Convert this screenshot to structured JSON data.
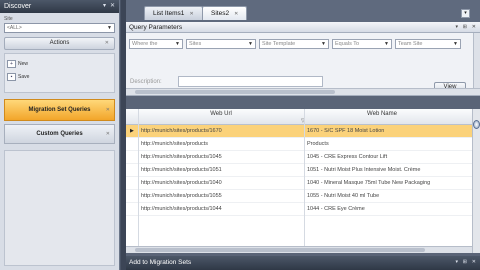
{
  "discover": {
    "title": "Discover",
    "site_label": "Site",
    "site_value": "<ALL>",
    "actions_label": "Actions",
    "new_label": "New",
    "save_label": "Save",
    "migration_set_queries": "Migration Set Queries",
    "custom_queries": "Custom Queries"
  },
  "tabs": [
    {
      "label": "List Items1",
      "active": false
    },
    {
      "label": "Sites2",
      "active": true
    }
  ],
  "query_parameters": {
    "title": "Query Parameters",
    "combo1": "Where the",
    "combo2": "Sites",
    "combo3": "Site Template",
    "combo4": "Equals To",
    "combo5": "Team Site",
    "description_label": "Description:",
    "view_button": "View"
  },
  "grid": {
    "columns": [
      "Web Url",
      "Web Name"
    ],
    "rows": [
      {
        "url": "http://munich/sites/products/1670",
        "name": "1670 - S/C SPF 18 Moist Lotion",
        "selected": true
      },
      {
        "url": "http://munich/sites/products",
        "name": "Products",
        "selected": false
      },
      {
        "url": "http://munich/sites/products/1045",
        "name": "1045 - CRE Express Contour Lift",
        "selected": false
      },
      {
        "url": "http://munich/sites/products/1051",
        "name": "1051 - Nutri Moist Plus Intensive Moist. Crème",
        "selected": false
      },
      {
        "url": "http://munich/sites/products/1040",
        "name": "1040 - Mineral Masque 75ml Tube New Packaging",
        "selected": false
      },
      {
        "url": "http://munich/sites/products/1055",
        "name": "1055 - Nutri Moist 40 ml Tube",
        "selected": false
      },
      {
        "url": "http://munich/sites/products/1044",
        "name": "1044 - CRE Eye Crème",
        "selected": false
      }
    ]
  },
  "bottom_panel": {
    "title": "Add to Migration Sets"
  },
  "colors": {
    "selection": "#fbd27a",
    "active_nav": "#f2a52a",
    "title_bar": "#2f3846"
  }
}
